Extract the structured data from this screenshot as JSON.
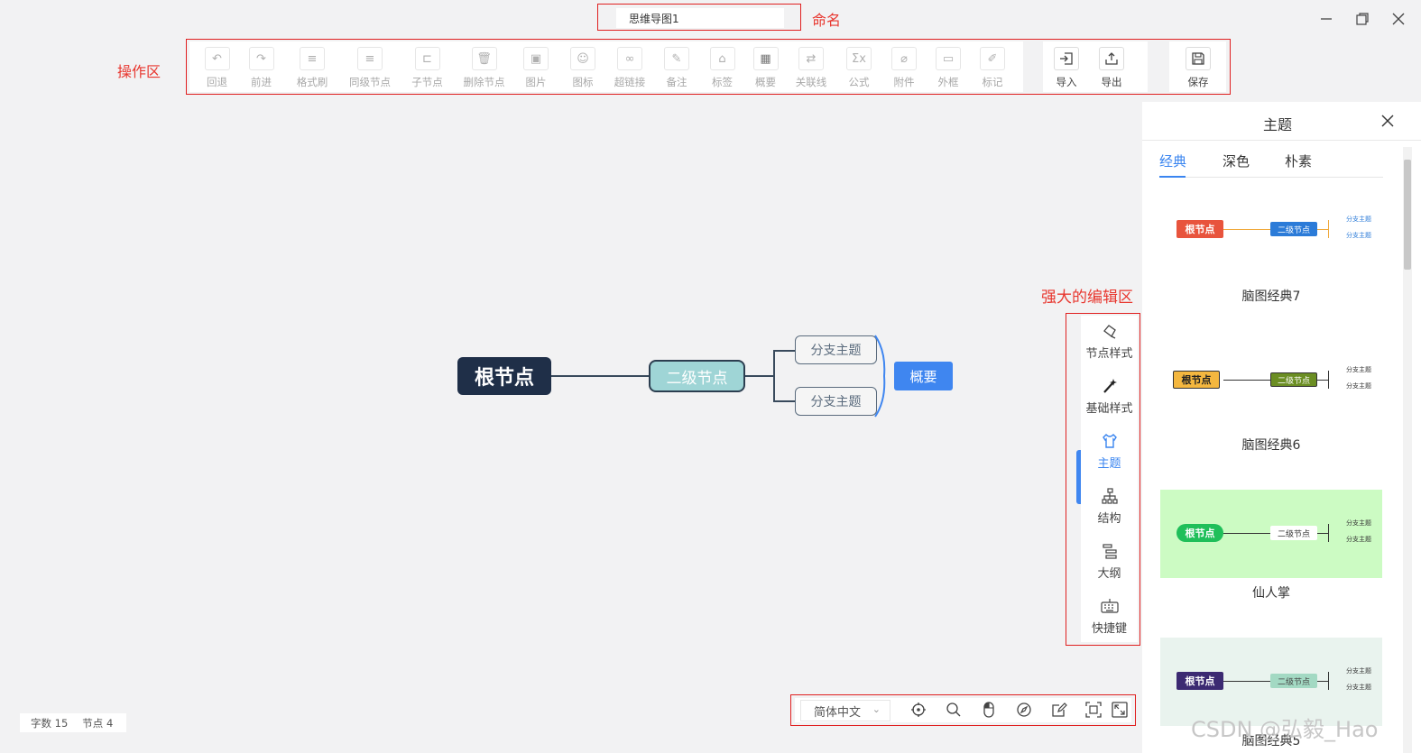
{
  "window": {
    "filename": "思维导图1",
    "minimize_icon": "minimize-icon",
    "restore_icon": "restore-icon",
    "close_icon": "close-icon"
  },
  "annotations": {
    "naming": "命名",
    "operations": "操作区",
    "editor": "强大的编辑区"
  },
  "toolbar": {
    "tools": [
      {
        "label": "回退",
        "icon": "undo-icon"
      },
      {
        "label": "前进",
        "icon": "redo-icon"
      },
      {
        "label": "格式刷",
        "icon": "format-brush-icon"
      },
      {
        "label": "同级节点",
        "icon": "sibling-node-icon"
      },
      {
        "label": "子节点",
        "icon": "child-node-icon"
      },
      {
        "label": "删除节点",
        "icon": "delete-icon"
      },
      {
        "label": "图片",
        "icon": "image-icon"
      },
      {
        "label": "图标",
        "icon": "emoji-icon"
      },
      {
        "label": "超链接",
        "icon": "link-icon"
      },
      {
        "label": "备注",
        "icon": "note-icon"
      },
      {
        "label": "标签",
        "icon": "tag-icon"
      },
      {
        "label": "概要",
        "icon": "summary-icon"
      },
      {
        "label": "关联线",
        "icon": "relation-line-icon"
      },
      {
        "label": "公式",
        "icon": "formula-icon"
      },
      {
        "label": "附件",
        "icon": "attachment-icon"
      },
      {
        "label": "外框",
        "icon": "frame-icon"
      },
      {
        "label": "标记",
        "icon": "mark-icon"
      }
    ],
    "import_label": "导入",
    "export_label": "导出",
    "save_label": "保存"
  },
  "mindmap": {
    "root": "根节点",
    "second": "二级节点",
    "branches": [
      "分支主题",
      "分支主题"
    ],
    "summary": "概要"
  },
  "side_tabs": [
    {
      "label": "节点样式",
      "icon": "node-style-icon"
    },
    {
      "label": "基础样式",
      "icon": "magic-wand-icon"
    },
    {
      "label": "主题",
      "icon": "shirt-icon",
      "active": true
    },
    {
      "label": "结构",
      "icon": "structure-icon"
    },
    {
      "label": "大纲",
      "icon": "outline-icon"
    },
    {
      "label": "快捷键",
      "icon": "keyboard-icon"
    }
  ],
  "theme_panel": {
    "title": "主题",
    "tabs": [
      "经典",
      "深色",
      "朴素"
    ],
    "active_tab": "经典",
    "themes": [
      {
        "name": "脑图经典7",
        "root": "根节点",
        "second": "二级节点",
        "branch": "分支主题",
        "root_color": "#e8543d",
        "second_color": "#2b7bd8",
        "line_color": "#f0a93b",
        "bg": "#ffffff"
      },
      {
        "name": "脑图经典6",
        "root": "根节点",
        "second": "二级节点",
        "branch": "分支主题",
        "root_color": "#f4b73f",
        "second_color": "#6b8e23",
        "line_color": "#333333",
        "bg": "#ffffff"
      },
      {
        "name": "仙人掌",
        "root": "根节点",
        "second": "二级节点",
        "branch": "分支主题",
        "root_color": "#1fbf5a",
        "second_color": "#ffffff",
        "line_color": "#333333",
        "bg": "#ccfbc3"
      },
      {
        "name": "脑图经典5",
        "root": "根节点",
        "second": "二级节点",
        "branch": "分支主题",
        "root_color": "#3c2a72",
        "second_color": "#a3d9c3",
        "line_color": "#333333",
        "bg": "#e9f3ee"
      }
    ]
  },
  "status": {
    "word_count_label": "字数",
    "word_count": "15",
    "node_count_label": "节点",
    "node_count": "4"
  },
  "bottom_bar": {
    "language": "简体中文"
  },
  "watermark": "CSDN @弘毅_Hao"
}
